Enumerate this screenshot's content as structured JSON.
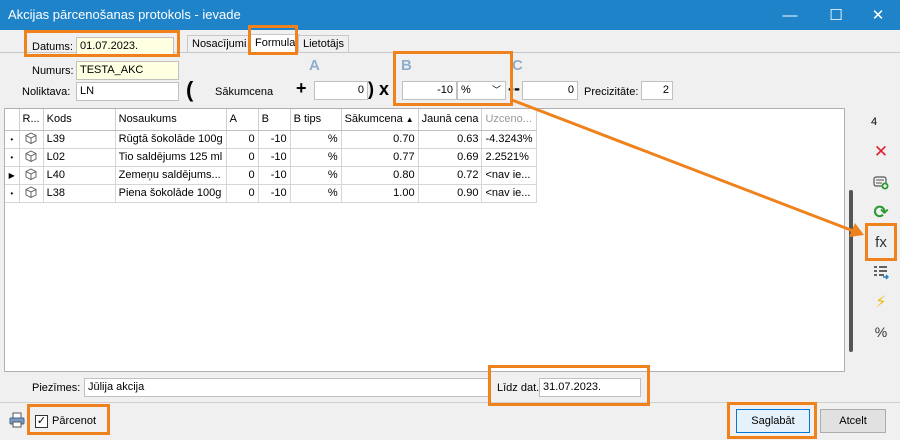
{
  "window": {
    "title": "Akcijas pārcenošanas protokols - ievade",
    "minimize_glyph": "—",
    "maximize_glyph": "☐",
    "close_glyph": "✕"
  },
  "tabs": [
    {
      "label": "Nosacījumi"
    },
    {
      "label": "Formula"
    },
    {
      "label": "Lietotājs"
    }
  ],
  "form": {
    "datums_label": "Datums:",
    "datums_value": "01.07.2023.",
    "numurs_label": "Numurs:",
    "numurs_value": "TESTA_AKC",
    "noliktava_label": "Noliktava:",
    "noliktava_value": "LN"
  },
  "formula": {
    "open_paren": "(",
    "sakumcena_label": "Sākumcena",
    "plus": "+",
    "a_letter": "A",
    "a_value": "0",
    "close_paren_x": ") x",
    "b_letter": "B",
    "b_value": "-10",
    "b_type": "%",
    "minus": "--",
    "c_letter": "C",
    "c_value": "0",
    "precizitate_label": "Precizitāte:",
    "precizitate_value": "2"
  },
  "grid": {
    "headers": [
      "R...",
      "Kods",
      "Nosaukums",
      "A",
      "B",
      "B tips",
      "Sākumcena",
      "Jaunā cena",
      "Uzceno..."
    ],
    "rows": [
      {
        "indicator": "•",
        "kods": "L39",
        "nosaukums": "Rūgtā šokolāde 100g",
        "a": "0",
        "b": "-10",
        "btips": "%",
        "sakumcena": "0.70",
        "jauna_cena": "0.63",
        "uzcenojums": "-4.3243%"
      },
      {
        "indicator": "•",
        "kods": "L02",
        "nosaukums": "Tio saldējums 125 ml",
        "a": "0",
        "b": "-10",
        "btips": "%",
        "sakumcena": "0.77",
        "jauna_cena": "0.69",
        "uzcenojums": "2.2521%"
      },
      {
        "indicator": "▶",
        "kods": "L40",
        "nosaukums": "Zemeņu saldējums...",
        "a": "0",
        "b": "-10",
        "btips": "%",
        "sakumcena": "0.80",
        "jauna_cena": "0.72",
        "uzcenojums": "<nav ie..."
      },
      {
        "indicator": "•",
        "kods": "L38",
        "nosaukums": "Piena šokolāde 100g",
        "a": "0",
        "b": "-10",
        "btips": "%",
        "sakumcena": "1.00",
        "jauna_cena": "0.90",
        "uzcenojums": "<nav ie..."
      }
    ]
  },
  "toolbar": {
    "count": "4",
    "delete_glyph": "✕",
    "refresh_glyph": "⟳",
    "formula_label": "fx",
    "lightning_glyph": "⚡",
    "percent_label": "%"
  },
  "bottom": {
    "piezimes_label": "Piezīmes:",
    "piezimes_value": "Jūlija akcija",
    "lidz_label": "Līdz dat.",
    "lidz_value": "31.07.2023.",
    "parcenot_label": "Pārcenot",
    "parcenot_check": "✓",
    "save_label": "Saglabāt",
    "cancel_label": "Atcelt"
  },
  "colors": {
    "titlebar": "#1f83c9",
    "highlight": "#f0821e",
    "delete_red": "#e0202a",
    "refresh_green": "#2c9a35",
    "lightning_yellow": "#f2b705"
  }
}
